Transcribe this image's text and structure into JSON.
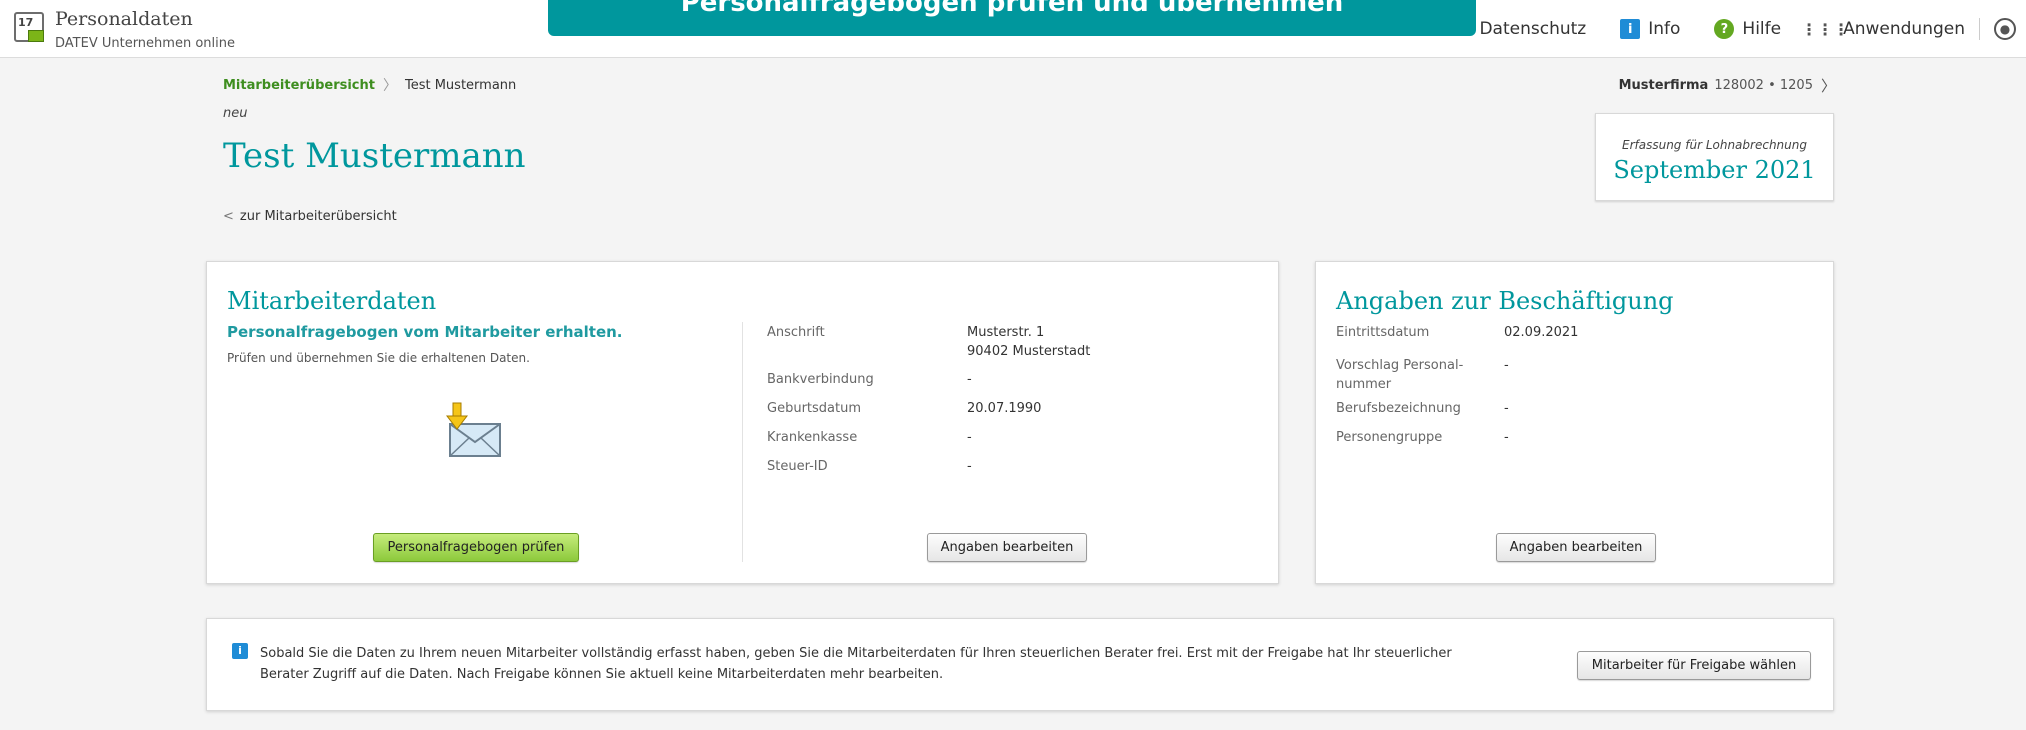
{
  "header": {
    "app_icon_number": "17",
    "app_title": "Personaldaten",
    "app_subtitle": "DATEV Unternehmen online",
    "tooltip_banner": "Personalfragebogen prüfen und übernehmen",
    "nav": {
      "privacy": "Datenschutz",
      "info": "Info",
      "help": "Hilfe",
      "apps": "Anwendungen"
    }
  },
  "breadcrumb": {
    "parent": "Mitarbeiterübersicht",
    "current": "Test Mustermann"
  },
  "firm": {
    "name": "Musterfirma",
    "number": "128002 • 1205"
  },
  "employee": {
    "status": "neu",
    "name": "Test Mustermann",
    "back_link": "zur Mitarbeiterübersicht"
  },
  "period": {
    "label": "Erfassung für Lohnabrechnung",
    "value": "September 2021"
  },
  "employee_card": {
    "title": "Mitarbeiterdaten",
    "questionnaire_heading": "Personalfragebogen vom Mitarbeiter erhalten.",
    "questionnaire_text": "Prüfen und übernehmen Sie die erhaltenen Daten.",
    "check_button": "Personalfragebogen prüfen",
    "fields": {
      "address_label": "Anschrift",
      "address_line1": "Musterstr. 1",
      "address_line2": "90402 Musterstadt",
      "bank_label": "Bankverbindung",
      "bank_value": "-",
      "birth_label": "Geburtsdatum",
      "birth_value": "20.07.1990",
      "insurance_label": "Krankenkasse",
      "insurance_value": "-",
      "taxid_label": "Steuer-ID",
      "taxid_value": "-"
    },
    "edit_button": "Angaben bearbeiten"
  },
  "employment_card": {
    "title": "Angaben zur Beschäftigung",
    "fields": {
      "entry_label": "Eintrittsdatum",
      "entry_value": "02.09.2021",
      "pnr_label_1": "Vorschlag Personal-",
      "pnr_label_2": "nummer",
      "pnr_value": "-",
      "job_label": "Berufsbezeichnung",
      "job_value": "-",
      "group_label": "Personengruppe",
      "group_value": "-"
    },
    "edit_button": "Angaben bearbeiten"
  },
  "info_bar": {
    "icon": "i",
    "text": "Sobald Sie die Daten zu Ihrem neuen Mitarbeiter vollständig erfasst haben, geben Sie die Mitarbeiterdaten für Ihren steuerlichen Berater frei. Erst mit der Freigabe hat Ihr steuerlicher Berater Zugriff auf die Daten. Nach Freigabe können Sie aktuell keine Mitarbeiterdaten mehr bearbeiten.",
    "release_button": "Mitarbeiter für Freigabe wählen"
  }
}
